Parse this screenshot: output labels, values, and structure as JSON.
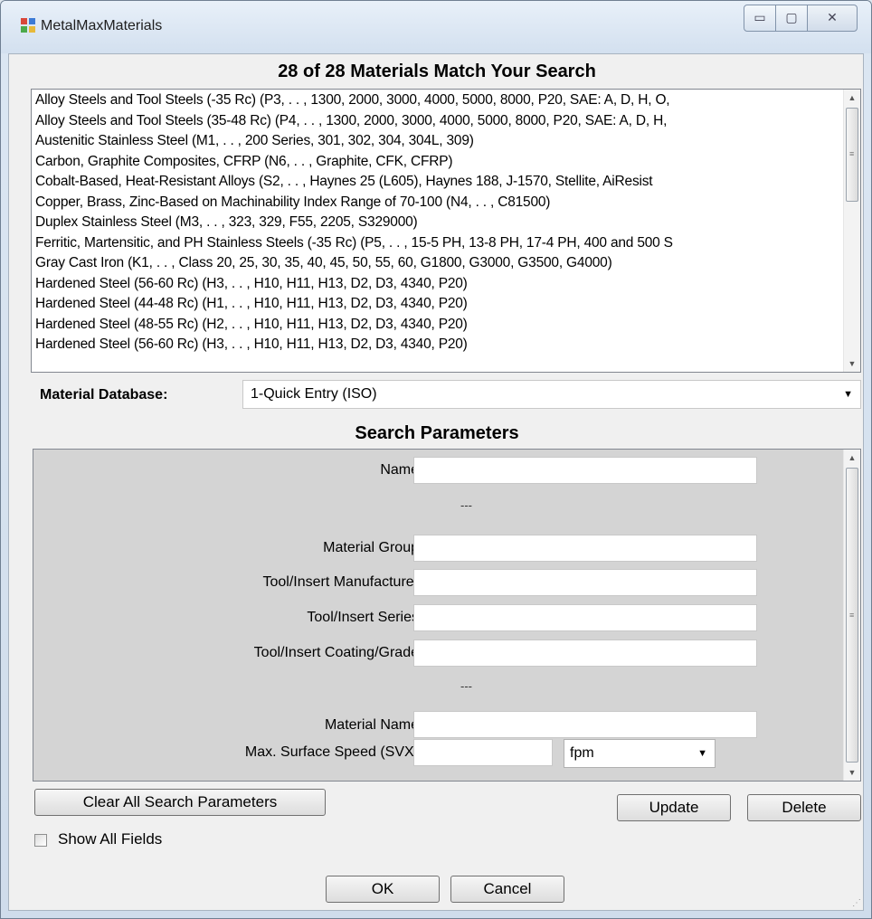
{
  "window": {
    "title": "MetalMaxMaterials",
    "controls": {
      "minimize": "▭",
      "maximize": "▢",
      "close": "✕"
    }
  },
  "results": {
    "header": "28 of 28 Materials Match Your Search",
    "items": [
      "Alloy Steels and Tool Steels (-35 Rc) (P3, . . , 1300, 2000, 3000, 4000, 5000, 8000, P20, SAE: A, D, H, O,",
      "Alloy Steels and Tool Steels (35-48 Rc) (P4, . . , 1300, 2000, 3000, 4000, 5000, 8000, P20, SAE: A, D, H,",
      "Austenitic Stainless Steel (M1, . . , 200 Series, 301, 302, 304, 304L, 309)",
      "Carbon, Graphite Composites, CFRP (N6, . . , Graphite, CFK, CFRP)",
      "Cobalt-Based, Heat-Resistant Alloys (S2, . . , Haynes 25 (L605), Haynes 188, J-1570, Stellite, AiResist",
      "Copper, Brass, Zinc-Based on Machinability Index Range of 70-100 (N4, . . , C81500)",
      "Duplex Stainless Steel (M3, . . , 323, 329, F55, 2205, S329000)",
      "Ferritic, Martensitic, and PH Stainless Steels (-35 Rc) (P5, . . , 15-5 PH, 13-8 PH, 17-4 PH, 400 and 500 S",
      "Gray Cast Iron (K1, . . , Class 20, 25, 30, 35, 40, 45, 50, 55, 60, G1800, G3000, G3500, G4000)",
      "Hardened Steel (56-60 Rc) (H3, . . , H10, H11, H13, D2, D3, 4340, P20)",
      "Hardened Steel (44-48 Rc) (H1, . . , H10, H11, H13, D2, D3, 4340, P20)",
      "Hardened Steel (48-55 Rc) (H2, . . , H10, H11, H13, D2, D3, 4340, P20)",
      "Hardened Steel (56-60 Rc) (H3, . . , H10, H11, H13, D2, D3, 4340, P20)"
    ]
  },
  "database": {
    "label": "Material Database:",
    "selected": "1-Quick Entry (ISO)"
  },
  "search": {
    "title": "Search Parameters",
    "separator": "---",
    "fields": {
      "name": {
        "label": "Name",
        "value": ""
      },
      "material_group": {
        "label": "Material Group",
        "value": ""
      },
      "tool_manufacturer": {
        "label": "Tool/Insert Manufacturer",
        "value": ""
      },
      "tool_series": {
        "label": "Tool/Insert Series",
        "value": ""
      },
      "tool_coating": {
        "label": "Tool/Insert Coating/Grade",
        "value": ""
      },
      "material_name": {
        "label": "Material Name",
        "value": ""
      },
      "max_surface_speed": {
        "label": "Max. Surface Speed (SVX)",
        "value": "",
        "unit": "fpm"
      }
    }
  },
  "buttons": {
    "clear": "Clear All Search Parameters",
    "update": "Update",
    "delete": "Delete",
    "ok": "OK",
    "cancel": "Cancel"
  },
  "show_all_fields": {
    "label": "Show All Fields",
    "checked": false
  },
  "icons": [
    "app-icon",
    "minimize-icon",
    "maximize-icon",
    "close-icon",
    "scroll-up-icon",
    "scroll-down-icon",
    "dropdown-arrow-icon",
    "resize-grip-icon"
  ],
  "colors": {
    "titlebar": "#d3e0ef",
    "params_panel": "#d4d4d4",
    "client": "#f0f0f0"
  }
}
